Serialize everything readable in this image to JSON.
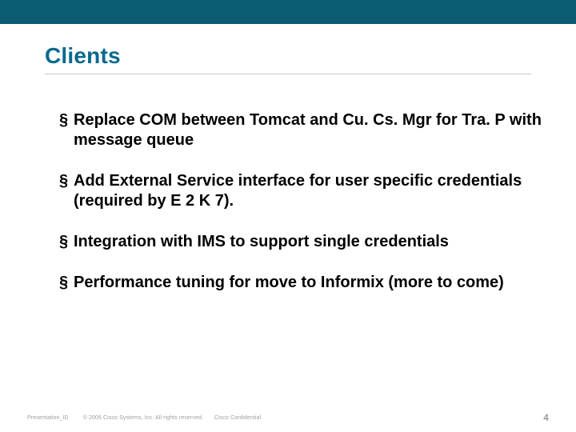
{
  "colors": {
    "accent": "#0b5b73",
    "title": "#076a8e"
  },
  "title": "Clients",
  "bullets": [
    "Replace COM between Tomcat and Cu. Cs. Mgr for Tra. P with message queue",
    "Add External Service interface for user specific credentials (required by E 2 K 7).",
    "Integration with IMS to support single credentials",
    "Performance tuning for move to Informix (more to come)"
  ],
  "footer": {
    "presentation_id": "Presentation_ID",
    "copyright": "© 2006 Cisco Systems, Inc. All rights reserved.",
    "confidential": "Cisco Confidential",
    "page": "4"
  }
}
